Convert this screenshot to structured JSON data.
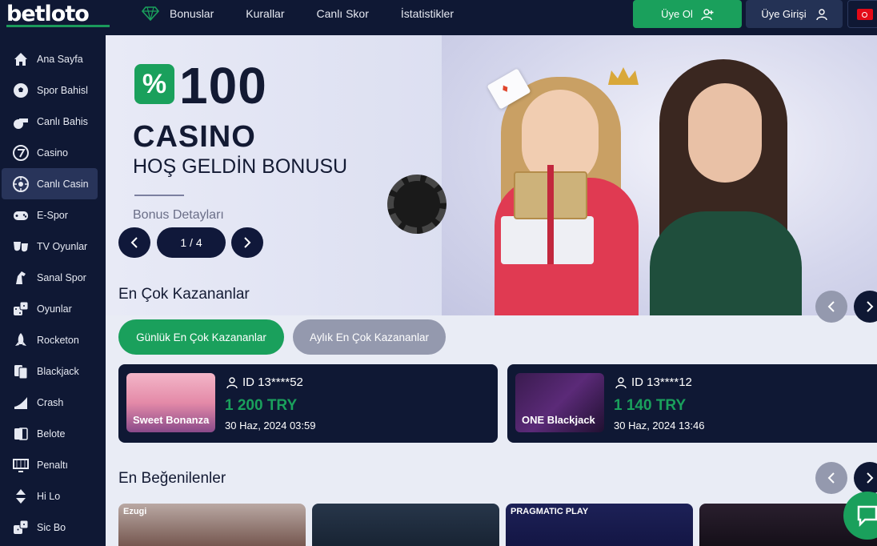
{
  "header": {
    "logo_part1": "bet",
    "logo_part2": "loto",
    "nav": [
      "Bonuslar",
      "Kurallar",
      "Canlı Skor",
      "İstatistikler"
    ],
    "register_label": "Üye Ol",
    "login_label": "Üye Girişi",
    "language_flag": "turkey-flag-icon"
  },
  "sidebar": {
    "items": [
      {
        "label": "Ana Sayfa",
        "icon": "home-icon"
      },
      {
        "label": "Spor Bahisl",
        "icon": "soccer-ball-icon"
      },
      {
        "label": "Canlı Bahis",
        "icon": "whistle-icon"
      },
      {
        "label": "Casino",
        "icon": "slot-seven-icon"
      },
      {
        "label": "Canlı Casin",
        "icon": "roulette-icon"
      },
      {
        "label": "E-Spor",
        "icon": "gamepad-icon"
      },
      {
        "label": "TV Oyunlar",
        "icon": "masks-icon"
      },
      {
        "label": "Sanal Spor",
        "icon": "horse-icon"
      },
      {
        "label": "Oyunlar",
        "icon": "dice-icon"
      },
      {
        "label": "Rocketon",
        "icon": "rocket-icon"
      },
      {
        "label": "Blackjack",
        "icon": "cards-icon"
      },
      {
        "label": "Crash",
        "icon": "chart-up-icon"
      },
      {
        "label": "Belote",
        "icon": "playing-cards-icon"
      },
      {
        "label": "Penaltı",
        "icon": "goal-icon"
      },
      {
        "label": "Hi Lo",
        "icon": "up-down-icon"
      },
      {
        "label": "Sic Bo",
        "icon": "dice-icon"
      }
    ],
    "active_index": 4
  },
  "hero": {
    "percent_symbol": "%",
    "amount": "100",
    "title": "CASINO",
    "subtitle": "HOŞ GELDİN BONUSU",
    "details_label": "Bonus Detayları",
    "slide_counter": "1 / 4"
  },
  "top_winners": {
    "title": "En Çok Kazananlar",
    "tab_daily": "Günlük En Çok Kazananlar",
    "tab_monthly": "Aylık En Çok Kazananlar",
    "cards": [
      {
        "user_id": "ID 13****52",
        "amount": "1 200 TRY",
        "date": "30 Haz, 2024 03:59",
        "game_thumb": "Sweet Bonanza"
      },
      {
        "user_id": "ID 13****12",
        "amount": "1 140 TRY",
        "date": "30 Haz, 2024 13:46",
        "game_thumb": "ONE Blackjack"
      }
    ]
  },
  "most_liked": {
    "title": "En Beğenilenler",
    "cards": [
      {
        "label": "Ezugi"
      },
      {
        "label": ""
      },
      {
        "label": "PRAGMATIC PLAY"
      },
      {
        "label": ""
      }
    ]
  },
  "colors": {
    "navy": "#0f1834",
    "green": "#1aa05c",
    "grey_pill": "#9499ae"
  }
}
